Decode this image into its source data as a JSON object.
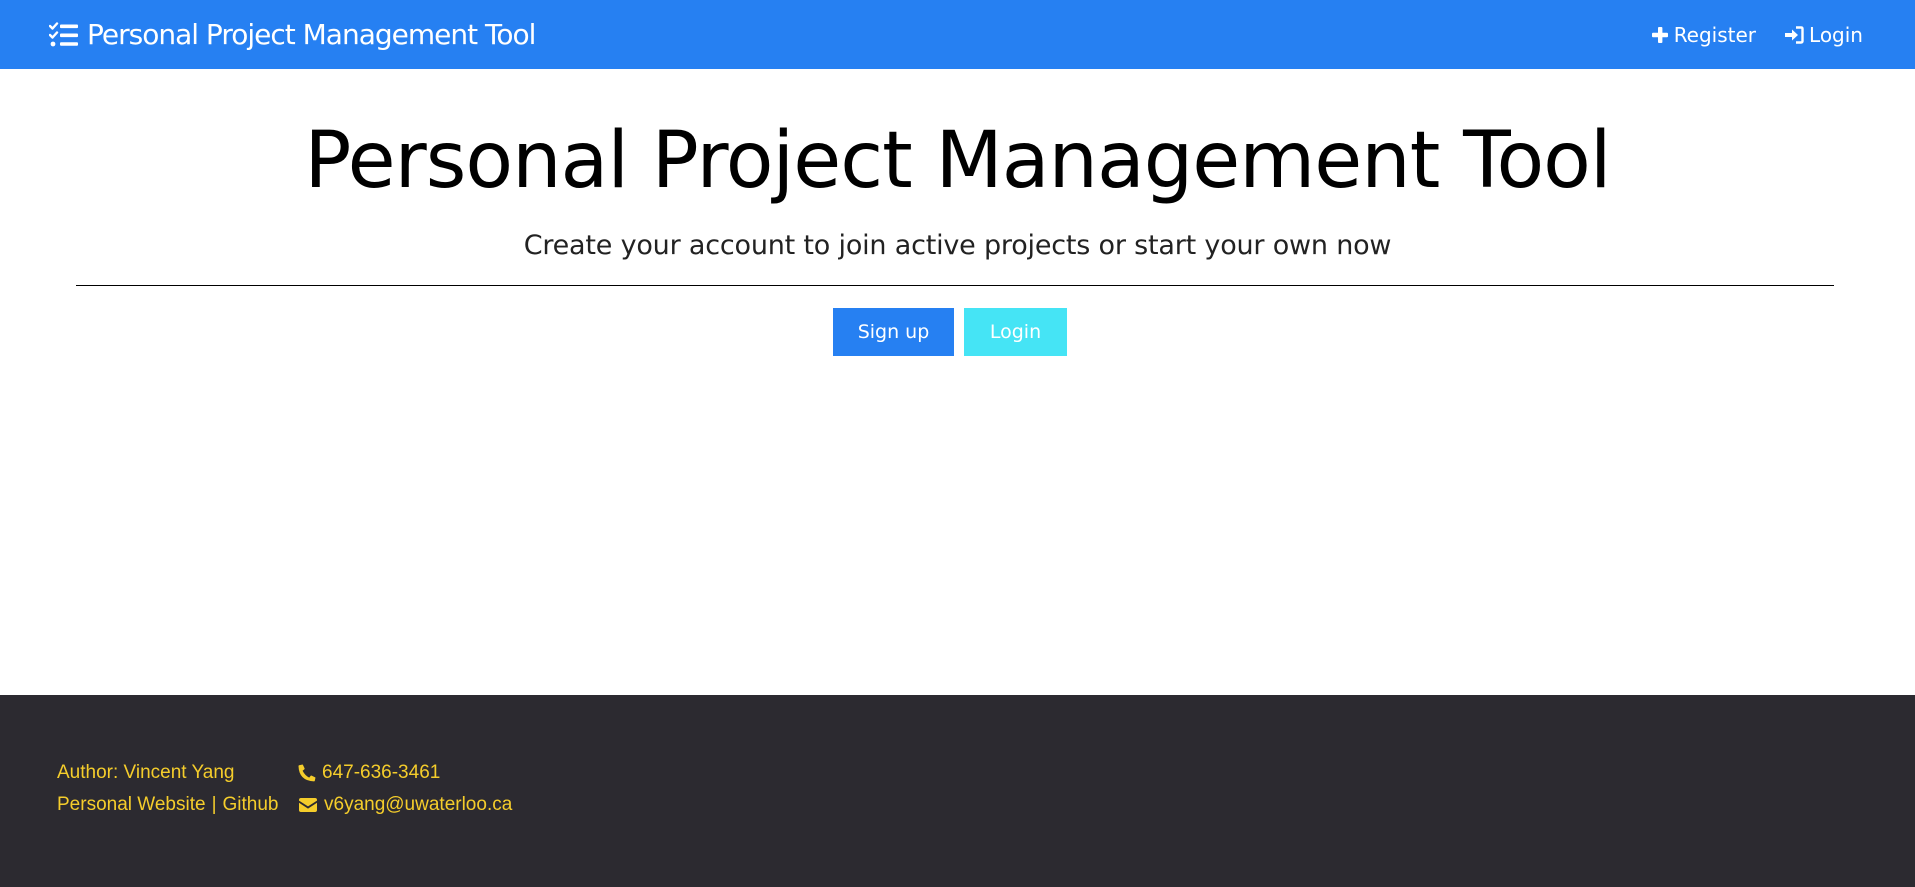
{
  "navbar": {
    "brand": "Personal Project Management Tool",
    "brand_icon": "tasks-list-icon",
    "register_label": "Register",
    "register_icon": "plus-icon",
    "login_label": "Login",
    "login_icon": "sign-in-icon",
    "background_color": "#2680f2"
  },
  "hero": {
    "title": "Personal Project Management Tool",
    "subtitle": "Create your account to join active projects or start your own now",
    "signup_label": "Sign up",
    "login_label": "Login",
    "signup_color": "#2680f2",
    "login_color": "#45e4f5"
  },
  "footer": {
    "author": "Author: Vincent Yang",
    "website_label": "Personal Website",
    "separator": "|",
    "github_label": "Github",
    "phone": "647-636-3461",
    "phone_icon": "phone-icon",
    "email": "v6yang@uwaterloo.ca",
    "email_icon": "envelope-icon",
    "background_color": "#2c2a30",
    "text_color": "#f5cd2b"
  }
}
